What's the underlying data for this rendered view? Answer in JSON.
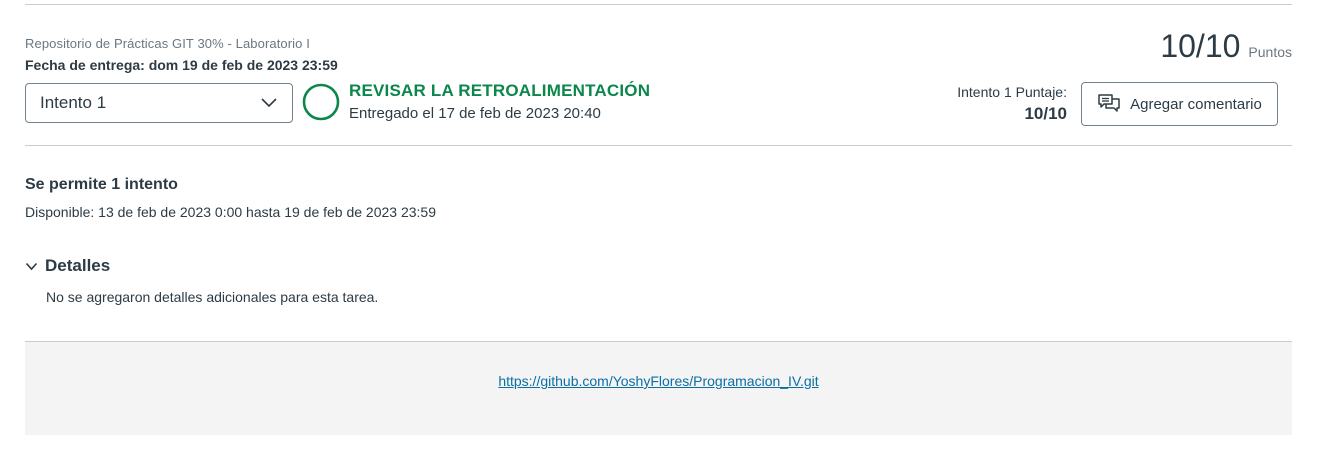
{
  "header": {
    "course_title": "Repositorio de Prácticas GIT 30% - Laboratorio I",
    "due_date": "Fecha de entrega: dom 19 de feb de 2023 23:59",
    "score": "10/10",
    "score_unit": "Puntos"
  },
  "attempt": {
    "selected": "Intento 1",
    "status_title": "REVISAR LA RETROALIMENTACIÓN",
    "status_sub": "Entregado el 17 de feb de 2023 20:40",
    "status_color": "#0b874b",
    "score_label": "Intento 1 Puntaje:",
    "score_value": "10/10",
    "comment_button": "Agregar comentario",
    "comment_icon": "comment-icon"
  },
  "info": {
    "allowed": "Se permite 1 intento",
    "available": "Disponible: 13 de feb de 2023 0:00 hasta 19 de feb de 2023 23:59"
  },
  "details": {
    "toggle_label": "Detalles",
    "toggle_icon": "chevron-down-icon",
    "text": "No se agregaron detalles adicionales para esta tarea."
  },
  "submission": {
    "link": "https://github.com/YoshyFlores/Programacion_IV.git",
    "link_color": "#0b6fa3"
  }
}
